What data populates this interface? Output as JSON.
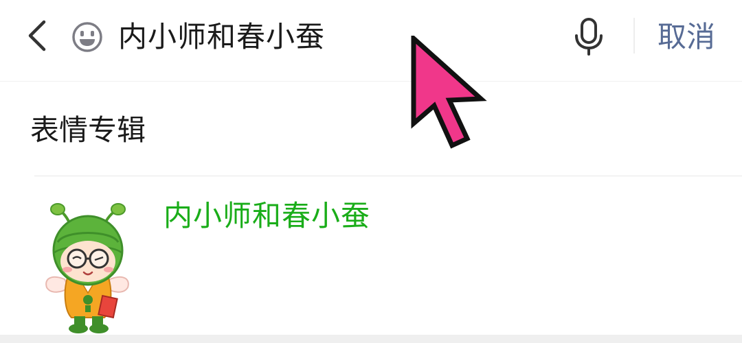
{
  "search": {
    "query": "内小师和春小蚕",
    "cancel_label": "取消",
    "back_icon": "chevron-left-icon",
    "emoji_icon": "smiley-icon",
    "mic_icon": "microphone-icon"
  },
  "section": {
    "title": "表情专辑"
  },
  "results": [
    {
      "title": "内小师和春小蚕",
      "thumbnail": "silkworm-mascot-sticker"
    }
  ],
  "colors": {
    "link_blue": "#576b95",
    "result_green": "#1aad19",
    "cursor_pink": "#f0378a"
  }
}
